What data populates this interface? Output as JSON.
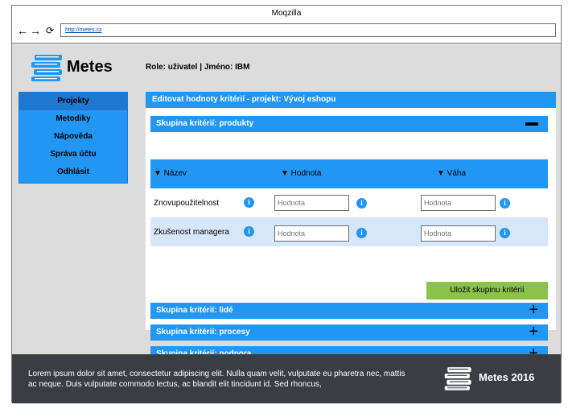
{
  "browser": {
    "title": "Moqzilla",
    "url": "http://metes.cz",
    "back_icon": "arrow-left-icon",
    "forward_icon": "arrow-right-icon",
    "reload_icon": "reload-icon"
  },
  "header": {
    "app_name": "Metes",
    "role_line": "Role: uživatel | Jméno: IBM"
  },
  "sidebar": {
    "items": [
      {
        "label": "Projekty",
        "active": true
      },
      {
        "label": "Metodiky"
      },
      {
        "label": "Nápověda"
      },
      {
        "label": "Správa účtu"
      },
      {
        "label": "Odhlásit"
      }
    ]
  },
  "main": {
    "title": "Editovat hodnoty kritérií - projekt: Vývoj eshopu",
    "group_expanded": {
      "title": "Skupina kritérií: produkty",
      "toggle": "−",
      "columns": [
        "▼ Název",
        "▼ Hodnota",
        "▼ Váha"
      ],
      "rows": [
        {
          "name": "Znovupoužitelnost",
          "value_placeholder": "Hodnota",
          "weight_placeholder": "Hodnota"
        },
        {
          "name": "Zkušenost managera",
          "value_placeholder": "Hodnota",
          "weight_placeholder": "Hodnota"
        }
      ],
      "info_glyph": "i",
      "save_label": "Uložit skupinu kritérií"
    },
    "groups_collapsed": [
      {
        "title": "Skupina kritérií: lidé",
        "toggle": "+"
      },
      {
        "title": "Skupina kritérií: procesy",
        "toggle": "+"
      },
      {
        "title": "Skupina kritérií: podpora",
        "toggle": "+"
      }
    ]
  },
  "footer": {
    "text": "Lorem ipsum dolor sit amet, consectetur adipiscing elit. Nulla quam velit, vulputate eu pharetra nec, mattis ac neque. Duis vulputate commodo lectus, ac blandit elit tincidunt id. Sed rhoncus,",
    "brand": "Metes 2016"
  },
  "colors": {
    "accent": "#2196f3",
    "sidebar_active": "#1e78d0",
    "save_button": "#8bc34a",
    "row_alt": "#d6e6fb",
    "footer_bg": "#3a3d42",
    "content_bg": "#dcdcdc"
  }
}
